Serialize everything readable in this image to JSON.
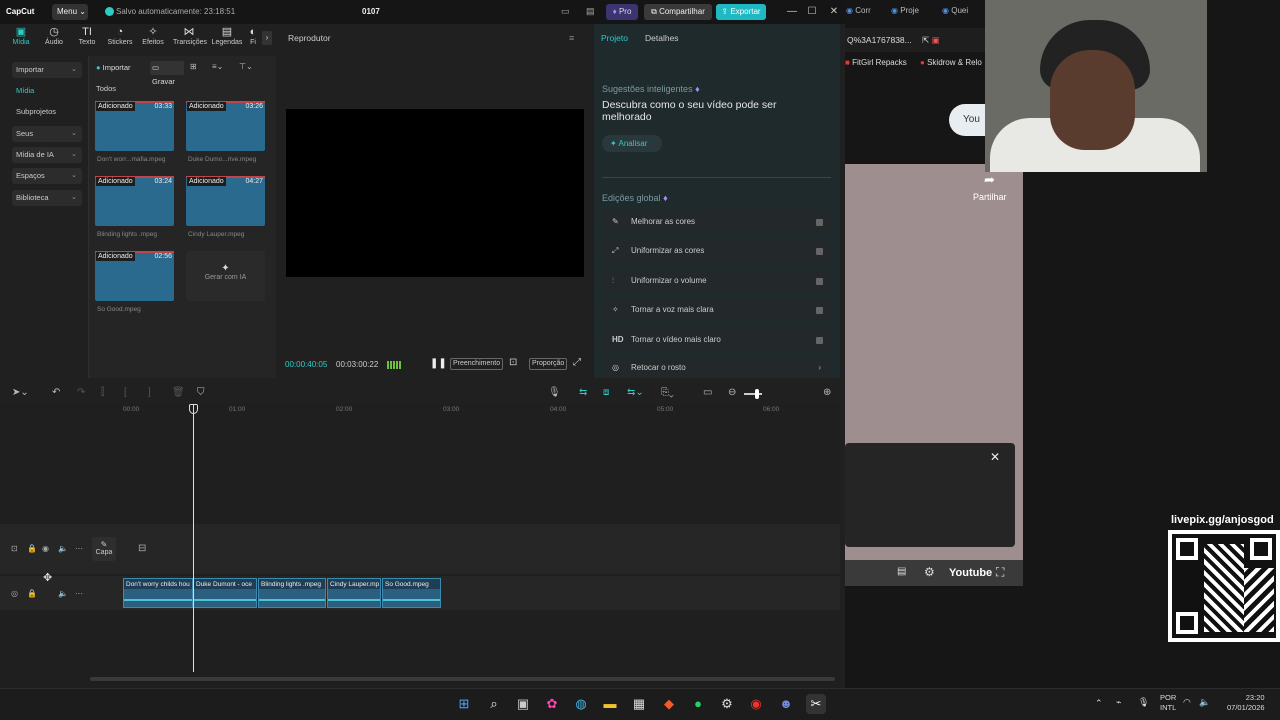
{
  "app": {
    "logo": "CapCut",
    "menu_label": "Menu",
    "autosave": "Salvo automaticamente: 23:18:51",
    "project_title": "0107",
    "pro_label": "Pro",
    "share_label": "Compartilhar",
    "export_label": "Exportar",
    "accent": "#2ecbc6"
  },
  "tool_tabs": [
    {
      "label": "Mídia",
      "icon": "media-icon"
    },
    {
      "label": "Áudio",
      "icon": "audio-icon"
    },
    {
      "label": "Texto",
      "icon": "text-icon"
    },
    {
      "label": "Stickers",
      "icon": "sticker-icon"
    },
    {
      "label": "Efeitos",
      "icon": "effects-icon"
    },
    {
      "label": "Transições",
      "icon": "transitions-icon"
    },
    {
      "label": "Legendas",
      "icon": "captions-icon"
    },
    {
      "label": "Fi",
      "icon": "filters-icon"
    }
  ],
  "left_nav": [
    {
      "label": "Importar"
    },
    {
      "label": "Mídia"
    },
    {
      "label": "Subprojetos"
    },
    {
      "label": "Seus"
    },
    {
      "label": "Mídia de IA"
    },
    {
      "label": "Espaços"
    },
    {
      "label": "Biblioteca"
    }
  ],
  "media": {
    "import_label": "Importar",
    "record_label": "Gravar",
    "all_label": "Todos",
    "items": [
      {
        "tag": "Adicionado",
        "duration": "03:33",
        "name": "Don't worr...mafia.mpeg"
      },
      {
        "tag": "Adicionado",
        "duration": "03:26",
        "name": "Duke Dumo...rive.mpeg"
      },
      {
        "tag": "Adicionado",
        "duration": "03:24",
        "name": "Blinding lights .mpeg"
      },
      {
        "tag": "Adicionado",
        "duration": "04:27",
        "name": "Cindy Lauper.mpeg"
      },
      {
        "tag": "Adicionado",
        "duration": "02:56",
        "name": "So Good.mpeg"
      }
    ],
    "generate_label": "Gerar com IA"
  },
  "player": {
    "title": "Reprodutor",
    "current_time": "00:00:40:05",
    "total_time": "00:03:00:22",
    "fill_label": "Preenchimento",
    "ratio_label": "Proporção"
  },
  "right_panel": {
    "tab_project": "Projeto",
    "tab_details": "Detalhes",
    "suggestions_title": "Sugestões inteligentes",
    "suggestions_desc": "Descubra como o seu vídeo pode ser melhorado",
    "analyze_label": "Analisar",
    "global_title": "Edições global",
    "edits": [
      {
        "label": "Melhorar as cores",
        "icon": "✎"
      },
      {
        "label": "Uniformizar as cores",
        "icon": "⤢"
      },
      {
        "label": "Uniformizar o volume",
        "icon": "⫶"
      },
      {
        "label": "Tornar a voz mais clara",
        "icon": "✧"
      },
      {
        "label": "Tornar o vídeo mais claro",
        "icon": "HD"
      },
      {
        "label": "Retocar o rosto",
        "icon": "◎"
      }
    ]
  },
  "timeline": {
    "ruler": [
      "00:00",
      "01:00",
      "02:00",
      "03:00",
      "04:00",
      "05:00",
      "06:00"
    ],
    "cover_label": "Capa",
    "clips": [
      "Don't worry childs hou",
      "Duke Dumont - oce",
      "Blinding lights .mpeg",
      "Cindy Lauper.mp",
      "So Good.mpeg"
    ]
  },
  "browser": {
    "tabs": [
      "Corr",
      "Proje",
      "Quei"
    ],
    "address": "Q%3A1767838...",
    "bookmarks": [
      "FitGirl Repacks",
      "Skidrow & Relo"
    ],
    "youtube_pill": "You",
    "share_label": "Partilhar",
    "youtube_label": "Youtube"
  },
  "overlay": {
    "livepix": "livepix.gg/anjosgod"
  },
  "taskbar": {
    "lang": "POR",
    "layout": "INTL",
    "time": "23:20",
    "date": "07/01/2026"
  }
}
